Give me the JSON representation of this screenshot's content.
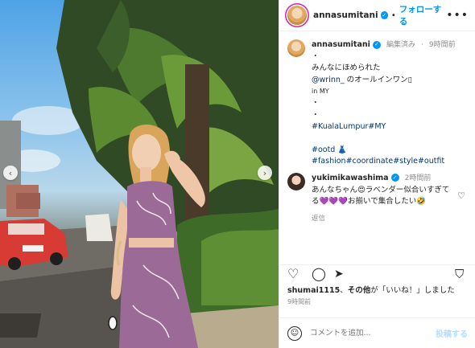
{
  "header": {
    "username": "annasumitani",
    "follow_label": "フォローする",
    "separator": "•",
    "more": "•••"
  },
  "caption": {
    "username": "annasumitani",
    "edited": "編集済み",
    "time": "9時間前",
    "lines": [
      "・",
      "みんなにほめられた"
    ],
    "mention": "@wrinn_",
    "mention_suffix": " のオールインワン▯",
    "in_my": "in MY",
    "dots": [
      "・",
      "・"
    ],
    "hashtag_place": "#KualaLumpur#MY",
    "hashtag_ootd": "#ootd 👗",
    "hashtags_fashion": "#fashion#coordinate#style#outfit"
  },
  "comment": {
    "username": "yukimikawashima",
    "time": "2時間前",
    "text": "あんなちゃん😍ラベンダー似合いすぎてる💜💜💜お揃いで集合したい🤣",
    "reply_label": "返信"
  },
  "likes": {
    "user": "shumai1115",
    "sep": "、",
    "others": "その他",
    "suffix": "が「いいね！」しました"
  },
  "post_time": "9時間前",
  "add_comment": {
    "placeholder": "コメントを追加...",
    "post_label": "投稿する"
  },
  "colors": {
    "accent": "#0095f6",
    "dress": "#9b6a96"
  }
}
